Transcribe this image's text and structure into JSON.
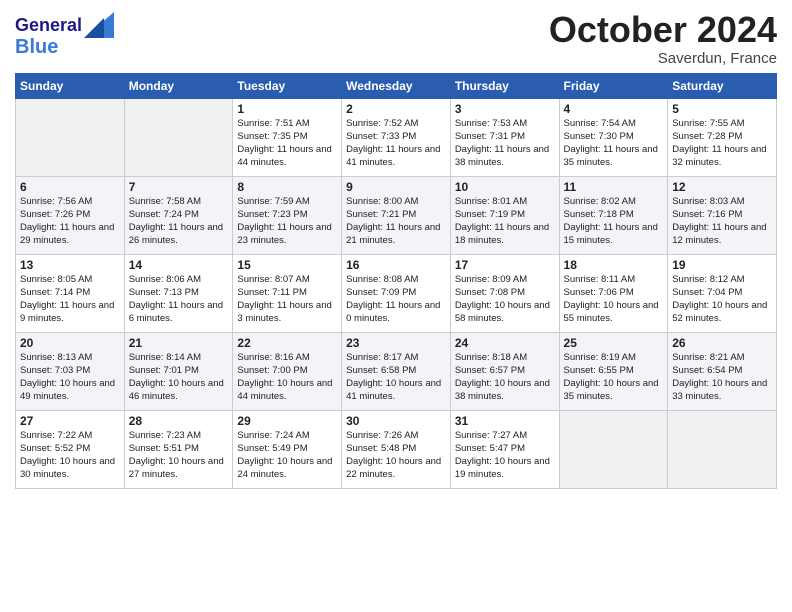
{
  "header": {
    "logo_line1": "General",
    "logo_line2": "Blue",
    "month": "October 2024",
    "location": "Saverdun, France"
  },
  "weekdays": [
    "Sunday",
    "Monday",
    "Tuesday",
    "Wednesday",
    "Thursday",
    "Friday",
    "Saturday"
  ],
  "weeks": [
    [
      {
        "day": "",
        "info": ""
      },
      {
        "day": "",
        "info": ""
      },
      {
        "day": "1",
        "sunrise": "Sunrise: 7:51 AM",
        "sunset": "Sunset: 7:35 PM",
        "daylight": "Daylight: 11 hours and 44 minutes."
      },
      {
        "day": "2",
        "sunrise": "Sunrise: 7:52 AM",
        "sunset": "Sunset: 7:33 PM",
        "daylight": "Daylight: 11 hours and 41 minutes."
      },
      {
        "day": "3",
        "sunrise": "Sunrise: 7:53 AM",
        "sunset": "Sunset: 7:31 PM",
        "daylight": "Daylight: 11 hours and 38 minutes."
      },
      {
        "day": "4",
        "sunrise": "Sunrise: 7:54 AM",
        "sunset": "Sunset: 7:30 PM",
        "daylight": "Daylight: 11 hours and 35 minutes."
      },
      {
        "day": "5",
        "sunrise": "Sunrise: 7:55 AM",
        "sunset": "Sunset: 7:28 PM",
        "daylight": "Daylight: 11 hours and 32 minutes."
      }
    ],
    [
      {
        "day": "6",
        "sunrise": "Sunrise: 7:56 AM",
        "sunset": "Sunset: 7:26 PM",
        "daylight": "Daylight: 11 hours and 29 minutes."
      },
      {
        "day": "7",
        "sunrise": "Sunrise: 7:58 AM",
        "sunset": "Sunset: 7:24 PM",
        "daylight": "Daylight: 11 hours and 26 minutes."
      },
      {
        "day": "8",
        "sunrise": "Sunrise: 7:59 AM",
        "sunset": "Sunset: 7:23 PM",
        "daylight": "Daylight: 11 hours and 23 minutes."
      },
      {
        "day": "9",
        "sunrise": "Sunrise: 8:00 AM",
        "sunset": "Sunset: 7:21 PM",
        "daylight": "Daylight: 11 hours and 21 minutes."
      },
      {
        "day": "10",
        "sunrise": "Sunrise: 8:01 AM",
        "sunset": "Sunset: 7:19 PM",
        "daylight": "Daylight: 11 hours and 18 minutes."
      },
      {
        "day": "11",
        "sunrise": "Sunrise: 8:02 AM",
        "sunset": "Sunset: 7:18 PM",
        "daylight": "Daylight: 11 hours and 15 minutes."
      },
      {
        "day": "12",
        "sunrise": "Sunrise: 8:03 AM",
        "sunset": "Sunset: 7:16 PM",
        "daylight": "Daylight: 11 hours and 12 minutes."
      }
    ],
    [
      {
        "day": "13",
        "sunrise": "Sunrise: 8:05 AM",
        "sunset": "Sunset: 7:14 PM",
        "daylight": "Daylight: 11 hours and 9 minutes."
      },
      {
        "day": "14",
        "sunrise": "Sunrise: 8:06 AM",
        "sunset": "Sunset: 7:13 PM",
        "daylight": "Daylight: 11 hours and 6 minutes."
      },
      {
        "day": "15",
        "sunrise": "Sunrise: 8:07 AM",
        "sunset": "Sunset: 7:11 PM",
        "daylight": "Daylight: 11 hours and 3 minutes."
      },
      {
        "day": "16",
        "sunrise": "Sunrise: 8:08 AM",
        "sunset": "Sunset: 7:09 PM",
        "daylight": "Daylight: 11 hours and 0 minutes."
      },
      {
        "day": "17",
        "sunrise": "Sunrise: 8:09 AM",
        "sunset": "Sunset: 7:08 PM",
        "daylight": "Daylight: 10 hours and 58 minutes."
      },
      {
        "day": "18",
        "sunrise": "Sunrise: 8:11 AM",
        "sunset": "Sunset: 7:06 PM",
        "daylight": "Daylight: 10 hours and 55 minutes."
      },
      {
        "day": "19",
        "sunrise": "Sunrise: 8:12 AM",
        "sunset": "Sunset: 7:04 PM",
        "daylight": "Daylight: 10 hours and 52 minutes."
      }
    ],
    [
      {
        "day": "20",
        "sunrise": "Sunrise: 8:13 AM",
        "sunset": "Sunset: 7:03 PM",
        "daylight": "Daylight: 10 hours and 49 minutes."
      },
      {
        "day": "21",
        "sunrise": "Sunrise: 8:14 AM",
        "sunset": "Sunset: 7:01 PM",
        "daylight": "Daylight: 10 hours and 46 minutes."
      },
      {
        "day": "22",
        "sunrise": "Sunrise: 8:16 AM",
        "sunset": "Sunset: 7:00 PM",
        "daylight": "Daylight: 10 hours and 44 minutes."
      },
      {
        "day": "23",
        "sunrise": "Sunrise: 8:17 AM",
        "sunset": "Sunset: 6:58 PM",
        "daylight": "Daylight: 10 hours and 41 minutes."
      },
      {
        "day": "24",
        "sunrise": "Sunrise: 8:18 AM",
        "sunset": "Sunset: 6:57 PM",
        "daylight": "Daylight: 10 hours and 38 minutes."
      },
      {
        "day": "25",
        "sunrise": "Sunrise: 8:19 AM",
        "sunset": "Sunset: 6:55 PM",
        "daylight": "Daylight: 10 hours and 35 minutes."
      },
      {
        "day": "26",
        "sunrise": "Sunrise: 8:21 AM",
        "sunset": "Sunset: 6:54 PM",
        "daylight": "Daylight: 10 hours and 33 minutes."
      }
    ],
    [
      {
        "day": "27",
        "sunrise": "Sunrise: 7:22 AM",
        "sunset": "Sunset: 5:52 PM",
        "daylight": "Daylight: 10 hours and 30 minutes."
      },
      {
        "day": "28",
        "sunrise": "Sunrise: 7:23 AM",
        "sunset": "Sunset: 5:51 PM",
        "daylight": "Daylight: 10 hours and 27 minutes."
      },
      {
        "day": "29",
        "sunrise": "Sunrise: 7:24 AM",
        "sunset": "Sunset: 5:49 PM",
        "daylight": "Daylight: 10 hours and 24 minutes."
      },
      {
        "day": "30",
        "sunrise": "Sunrise: 7:26 AM",
        "sunset": "Sunset: 5:48 PM",
        "daylight": "Daylight: 10 hours and 22 minutes."
      },
      {
        "day": "31",
        "sunrise": "Sunrise: 7:27 AM",
        "sunset": "Sunset: 5:47 PM",
        "daylight": "Daylight: 10 hours and 19 minutes."
      },
      {
        "day": "",
        "info": ""
      },
      {
        "day": "",
        "info": ""
      }
    ]
  ]
}
